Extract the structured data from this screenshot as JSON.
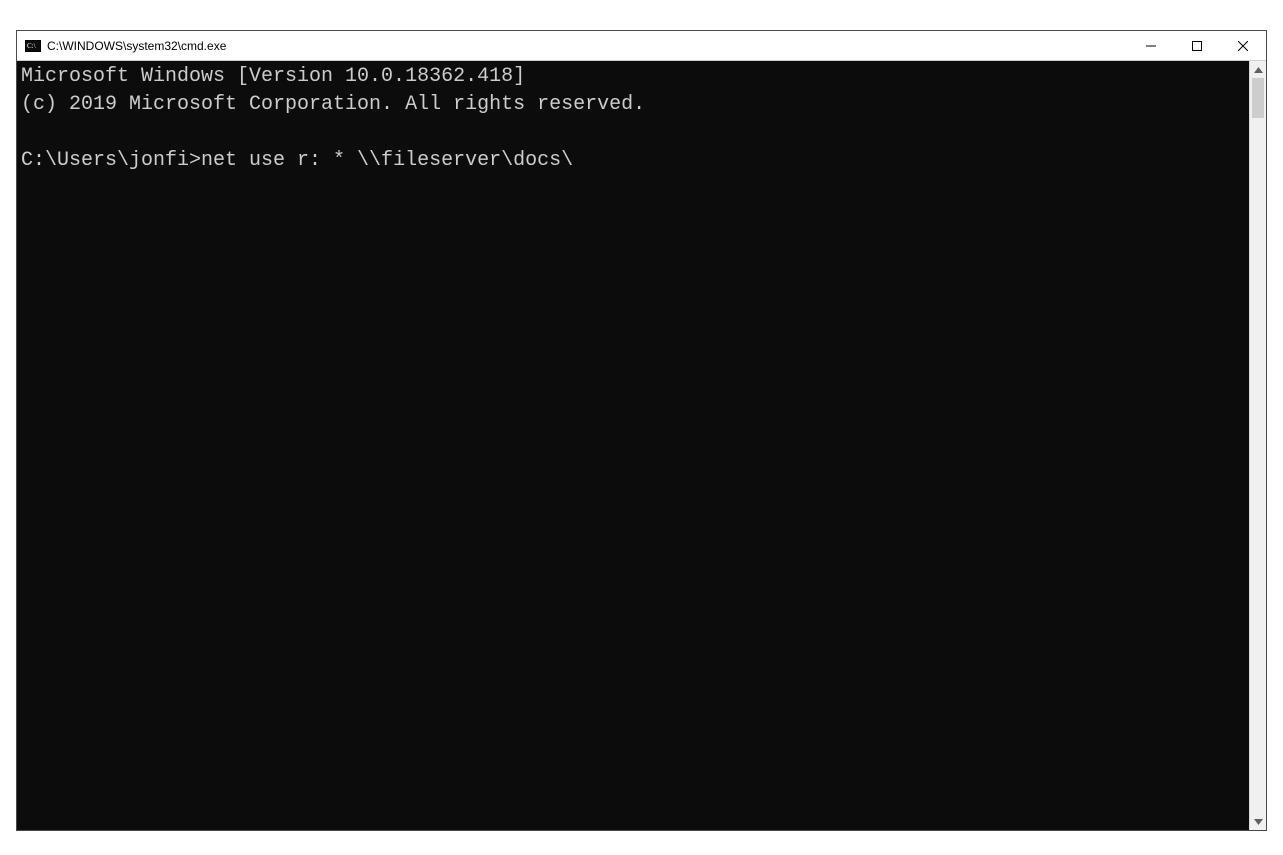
{
  "window": {
    "title": "C:\\WINDOWS\\system32\\cmd.exe"
  },
  "terminal": {
    "banner_line1": "Microsoft Windows [Version 10.0.18362.418]",
    "banner_line2": "(c) 2019 Microsoft Corporation. All rights reserved.",
    "prompt": "C:\\Users\\jonfi>",
    "command": "net use r: * \\\\fileserver\\docs\\"
  }
}
